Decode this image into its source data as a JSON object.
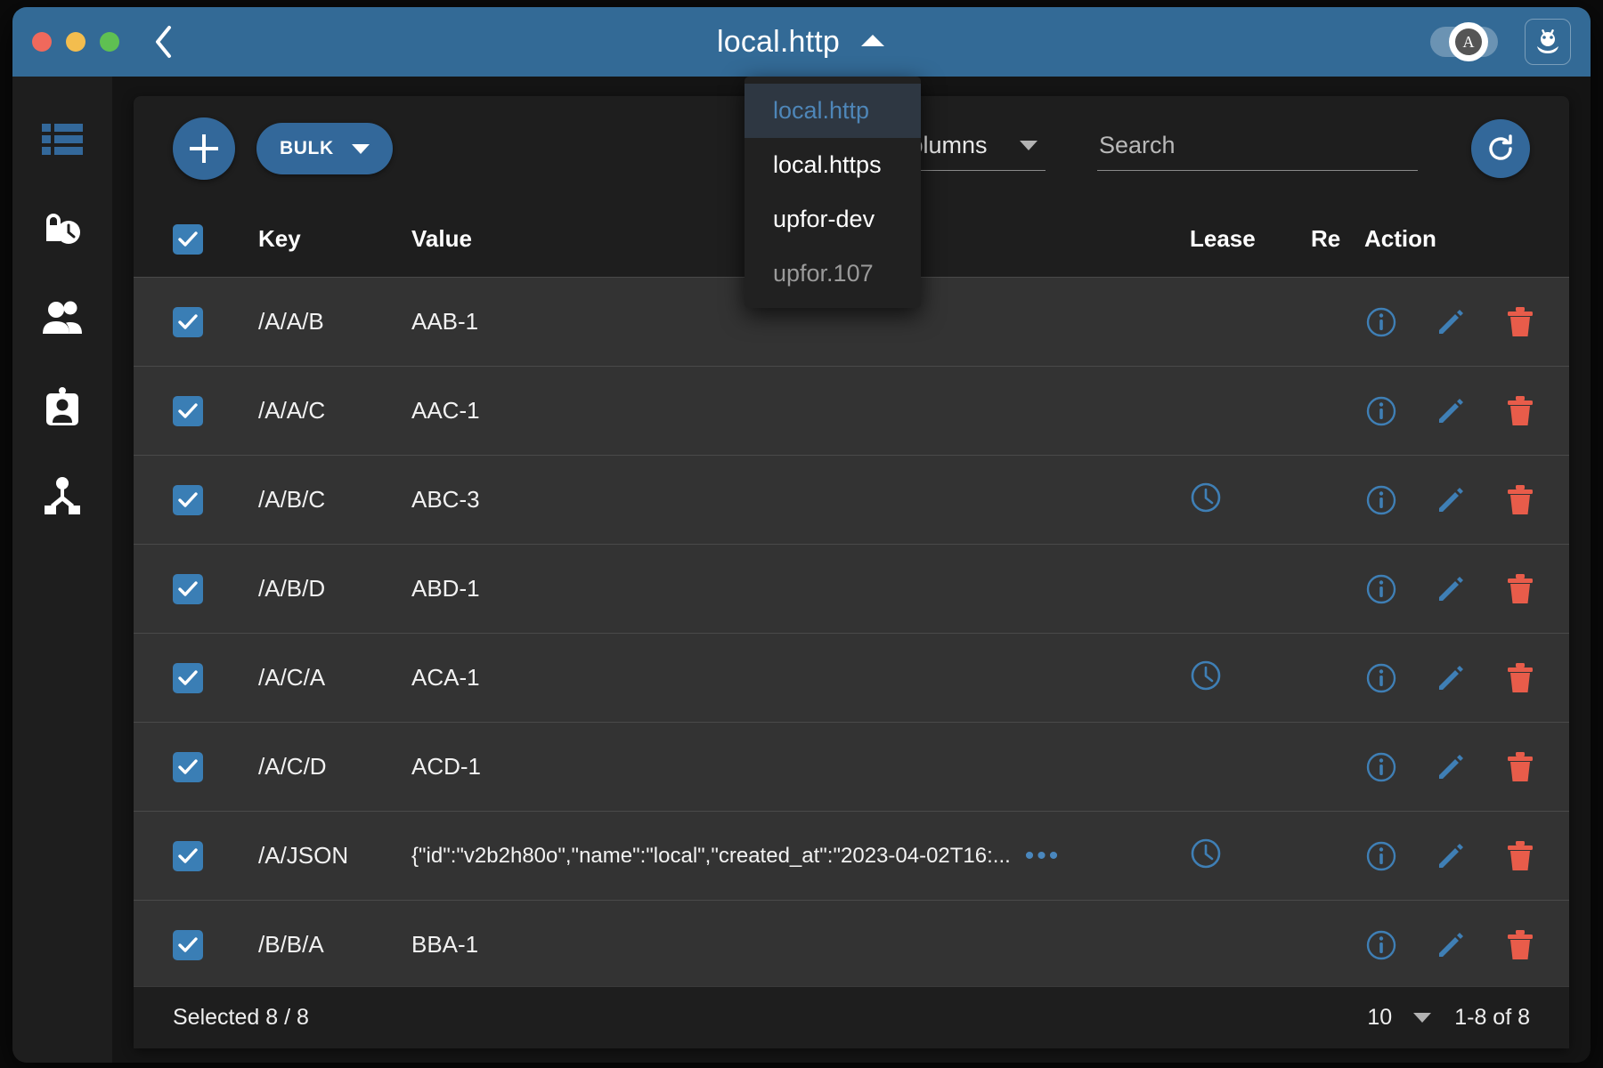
{
  "window": {
    "traffic_lights": [
      "close",
      "minimize",
      "maximize"
    ],
    "back_label": "back",
    "title": "local.http",
    "title_caret": "caret-up",
    "theme_toggle_label": "A",
    "bug_button_label": "debug"
  },
  "endpoint_menu": {
    "open": true,
    "items": [
      {
        "label": "local.http",
        "state": "selected"
      },
      {
        "label": "local.https",
        "state": "normal"
      },
      {
        "label": "upfor-dev",
        "state": "normal"
      },
      {
        "label": "upfor.107",
        "state": "dimmed"
      }
    ]
  },
  "sidebar": {
    "items": [
      {
        "name": "keys",
        "icon": "list-icon",
        "active": true
      },
      {
        "name": "leases",
        "icon": "lock-clock-icon",
        "active": false
      },
      {
        "name": "users",
        "icon": "users-icon",
        "active": false
      },
      {
        "name": "roles",
        "icon": "id-badge-icon",
        "active": false
      },
      {
        "name": "cluster",
        "icon": "hierarchy-icon",
        "active": false
      }
    ]
  },
  "toolbar": {
    "add_label": "+",
    "bulk_label": "BULK",
    "columns_label": "Columns",
    "search_placeholder": "Search",
    "search_value": "",
    "refresh_label": "refresh"
  },
  "table": {
    "headers": {
      "select_all": true,
      "key": "Key",
      "value": "Value",
      "lease": "Lease",
      "revision": "Re",
      "action": "Action"
    },
    "rows": [
      {
        "checked": true,
        "key": "/A/A/B",
        "value": "AAB-1",
        "lease": false
      },
      {
        "checked": true,
        "key": "/A/A/C",
        "value": "AAC-1",
        "lease": false
      },
      {
        "checked": true,
        "key": "/A/B/C",
        "value": "ABC-3",
        "lease": true
      },
      {
        "checked": true,
        "key": "/A/B/D",
        "value": "ABD-1",
        "lease": false
      },
      {
        "checked": true,
        "key": "/A/C/A",
        "value": "ACA-1",
        "lease": true
      },
      {
        "checked": true,
        "key": "/A/C/D",
        "value": "ACD-1",
        "lease": false
      },
      {
        "checked": true,
        "key": "/A/JSON",
        "value": "{\"id\":\"v2b2h80o\",\"name\":\"local\",\"created_at\":\"2023-04-02T16:...",
        "lease": true,
        "truncated": true
      },
      {
        "checked": true,
        "key": "/B/B/A",
        "value": "BBA-1",
        "lease": false
      }
    ],
    "action_icons": [
      "info-icon",
      "edit-icon",
      "delete-icon"
    ]
  },
  "footer": {
    "selected_text": "Selected 8 / 8",
    "rows_per_page": "10",
    "range_text": "1-8 of 8"
  },
  "colors": {
    "accent": "#33689a",
    "titlebar": "#336a96",
    "delete": "#e85c4a",
    "row_bg": "#333333",
    "card_bg": "#1e1e1e"
  }
}
